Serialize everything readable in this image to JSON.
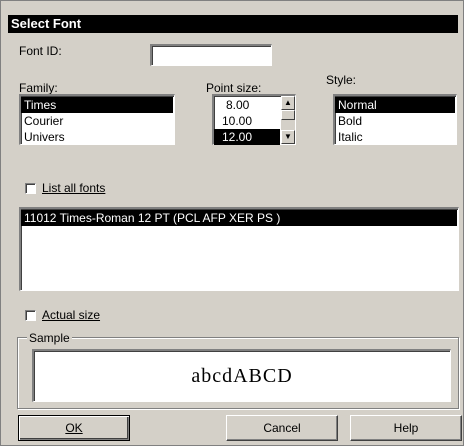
{
  "window": {
    "title": "Select Font"
  },
  "font_id": {
    "label": "Font ID:",
    "value": ""
  },
  "family": {
    "label": "Family:",
    "items": [
      "Times",
      "Courier",
      "Univers"
    ],
    "selected": "Times"
  },
  "point_size": {
    "label": "Point size:",
    "items": [
      "8.00",
      "10.00",
      "12.00"
    ],
    "selected": "12.00"
  },
  "style": {
    "label": "Style:",
    "items": [
      "Normal",
      "Bold",
      "Italic"
    ],
    "selected": "Normal"
  },
  "list_all_fonts": {
    "label": "List all fonts",
    "checked": false
  },
  "fonts_list": {
    "items": [
      "11012  Times-Roman 12 PT (PCL AFP XER PS )"
    ],
    "selected": "11012  Times-Roman 12 PT (PCL AFP XER PS )"
  },
  "actual_size": {
    "label": "Actual size",
    "checked": false
  },
  "sample": {
    "label": "Sample",
    "text": "abcdABCD"
  },
  "buttons": {
    "ok": "OK",
    "cancel": "Cancel",
    "help": "Help"
  }
}
